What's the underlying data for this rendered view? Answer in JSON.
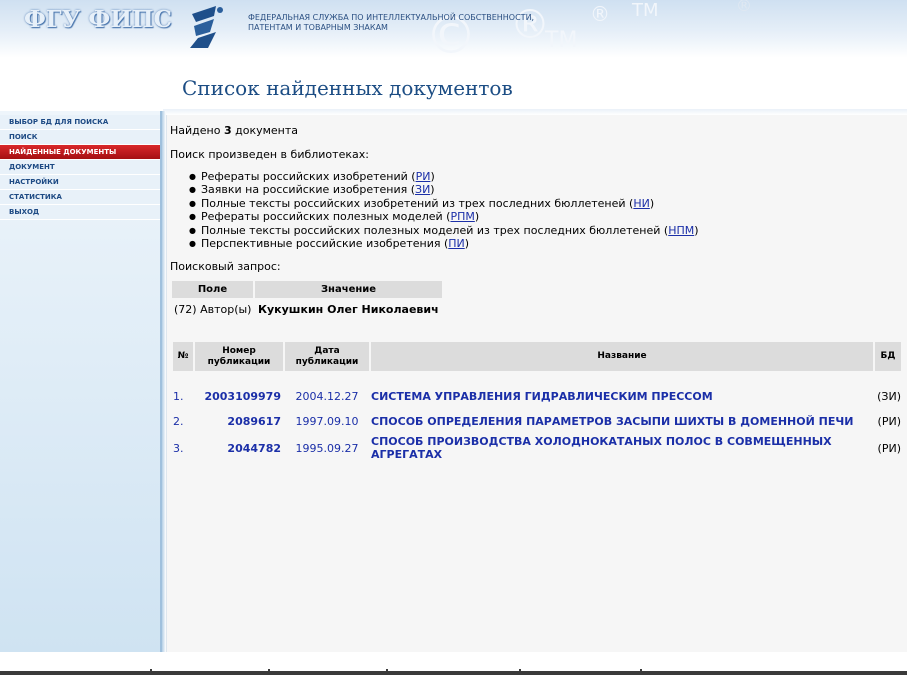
{
  "header": {
    "logo_text": "ФГУ ФИПС",
    "agency_line1": "ФЕДЕРАЛЬНАЯ СЛУЖБА ПО ИНТЕЛЛЕКТУАЛЬНОЙ СОБСТВЕННОСТИ,",
    "agency_line2": "ПАТЕНТАМ И ТОВАРНЫМ ЗНАКАМ",
    "watermark_c": "©",
    "watermark_r": "®",
    "watermark_tm": "TM"
  },
  "page_title": "Список найденных документов",
  "sidebar": {
    "items": [
      {
        "label": "ВЫБОР БД ДЛЯ ПОИСКА"
      },
      {
        "label": "ПОИСК"
      },
      {
        "label": "НАЙДЕННЫЕ ДОКУМЕНТЫ",
        "active": true
      },
      {
        "label": "ДОКУМЕНТ"
      },
      {
        "label": "НАСТРОЙКИ"
      },
      {
        "label": "СТАТИСТИКА"
      },
      {
        "label": "ВЫХОД"
      }
    ]
  },
  "content": {
    "found_prefix": "Найдено ",
    "found_count": "3",
    "found_suffix": " документа",
    "libraries_title": "Поиск произведен в библиотеках:",
    "libraries": [
      {
        "text": "Рефераты российских изобретений (",
        "code": "РИ",
        "end": ")"
      },
      {
        "text": "Заявки на российские изобретения (",
        "code": "ЗИ",
        "end": ")"
      },
      {
        "text": "Полные тексты российских изобретений из трех последних бюллетеней (",
        "code": "НИ",
        "end": ")"
      },
      {
        "text": "Рефераты российских полезных моделей (",
        "code": "РПМ",
        "end": ")"
      },
      {
        "text": "Полные тексты российских полезных моделей из трех последних бюллетеней (",
        "code": "НПМ",
        "end": ")"
      },
      {
        "text": "Перспективные российские изобретения (",
        "code": "ПИ",
        "end": ")"
      }
    ],
    "query_title": "Поисковый запрос:",
    "query_table": {
      "headers": [
        "Поле",
        "Значение"
      ],
      "field": "(72) Автор(ы)",
      "value": "Кукушкин Олег Николаевич"
    },
    "results_table": {
      "headers": {
        "num": "№",
        "pub_line1": "Номер",
        "pub_line2": "публикации",
        "date_line1": "Дата",
        "date_line2": "публикации",
        "name": "Название",
        "db": "БД"
      },
      "rows": [
        {
          "num": "1.",
          "pub": "2003109979",
          "date": "2004.12.27",
          "name": "СИСТЕМА УПРАВЛЕНИЯ ГИДРАВЛИЧЕСКИМ ПРЕССОМ",
          "db": "(ЗИ)"
        },
        {
          "num": "2.",
          "pub": "2089617",
          "date": "1997.09.10",
          "name": "СПОСОБ ОПРЕДЕЛЕНИЯ ПАРАМЕТРОВ ЗАСЫПИ ШИХТЫ В ДОМЕННОЙ ПЕЧИ",
          "db": "(РИ)"
        },
        {
          "num": "3.",
          "pub": "2044782",
          "date": "1995.09.27",
          "name": "СПОСОБ ПРОИЗВОДСТВА ХОЛОДНОКАТАНЫХ ПОЛОС В СОВМЕЩЕННЫХ АГРЕГАТАХ",
          "db": "(РИ)"
        }
      ]
    }
  },
  "colors": {
    "link": "#1b2fa8",
    "title": "#1c4d84",
    "active_nav": "#c0181b",
    "header_bg": "#cfe0f1"
  }
}
